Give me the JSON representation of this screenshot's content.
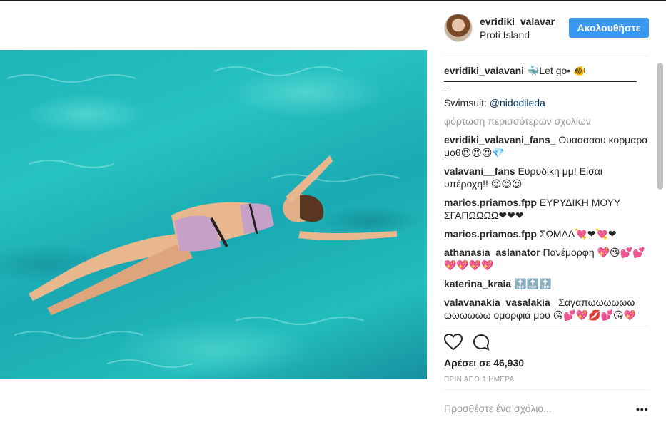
{
  "post": {
    "username": "evridiki_valavani",
    "location": "Proti Island",
    "follow_label": "Ακολουθήστε"
  },
  "comments": {
    "caption_user": "evridiki_valavani",
    "caption_text": "🐳Let go• 🐠",
    "caption_mark": "_",
    "swimsuit_label": "Swimsuit: ",
    "swimsuit_mention": "@nidodileda",
    "load_more": "φόρτωση περισσότερων σχολίων",
    "items": [
      {
        "user": "evridiki_valavani_fans_",
        "text": " Ουααααου κορμαρα μοθ😍😍😍💎"
      },
      {
        "user": "valavani__fans",
        "text": " Ευρυδίκη μμ! Είσαι υπέροχη!! 😍😍😍"
      },
      {
        "user": "marios.priamos.fpp",
        "text": " ΕΥΡΥΔΙΚΗ ΜΟΥΥ ΣΓΑΠΩΩΩΩ❤❤❤"
      },
      {
        "user": "marios.priamos.fpp",
        "text": " ΣΩΜΑΑ💘❤💘❤"
      },
      {
        "user": "athanasia_aslanator",
        "text": " Πανέμορφη 💖😘💕💕💖💖💖💖"
      },
      {
        "user": "katerina_kraia",
        "text": " 🔝🔝🔝"
      },
      {
        "user": "valavanakia_vasalakia_",
        "text": " Σαγαπωωωωωω ωωωωωω ομορφιά μου 😘💕💖💋💕😘💖"
      }
    ]
  },
  "icons": [
    "heart-icon",
    "comment-icon",
    "more-options-icon"
  ],
  "stats": {
    "likes": "Αρέσει σε 46,930",
    "time": "ΠΡΙΝ ΑΠΟ 1 ΗΜΕΡΑ"
  },
  "add_comment": {
    "placeholder": "Προσθέστε ένα σχόλιο...",
    "more": "•••"
  },
  "colors": {
    "accent": "#3897f0",
    "text": "#262626",
    "muted": "#999999",
    "mention": "#003569",
    "water": "#22bdbb"
  }
}
